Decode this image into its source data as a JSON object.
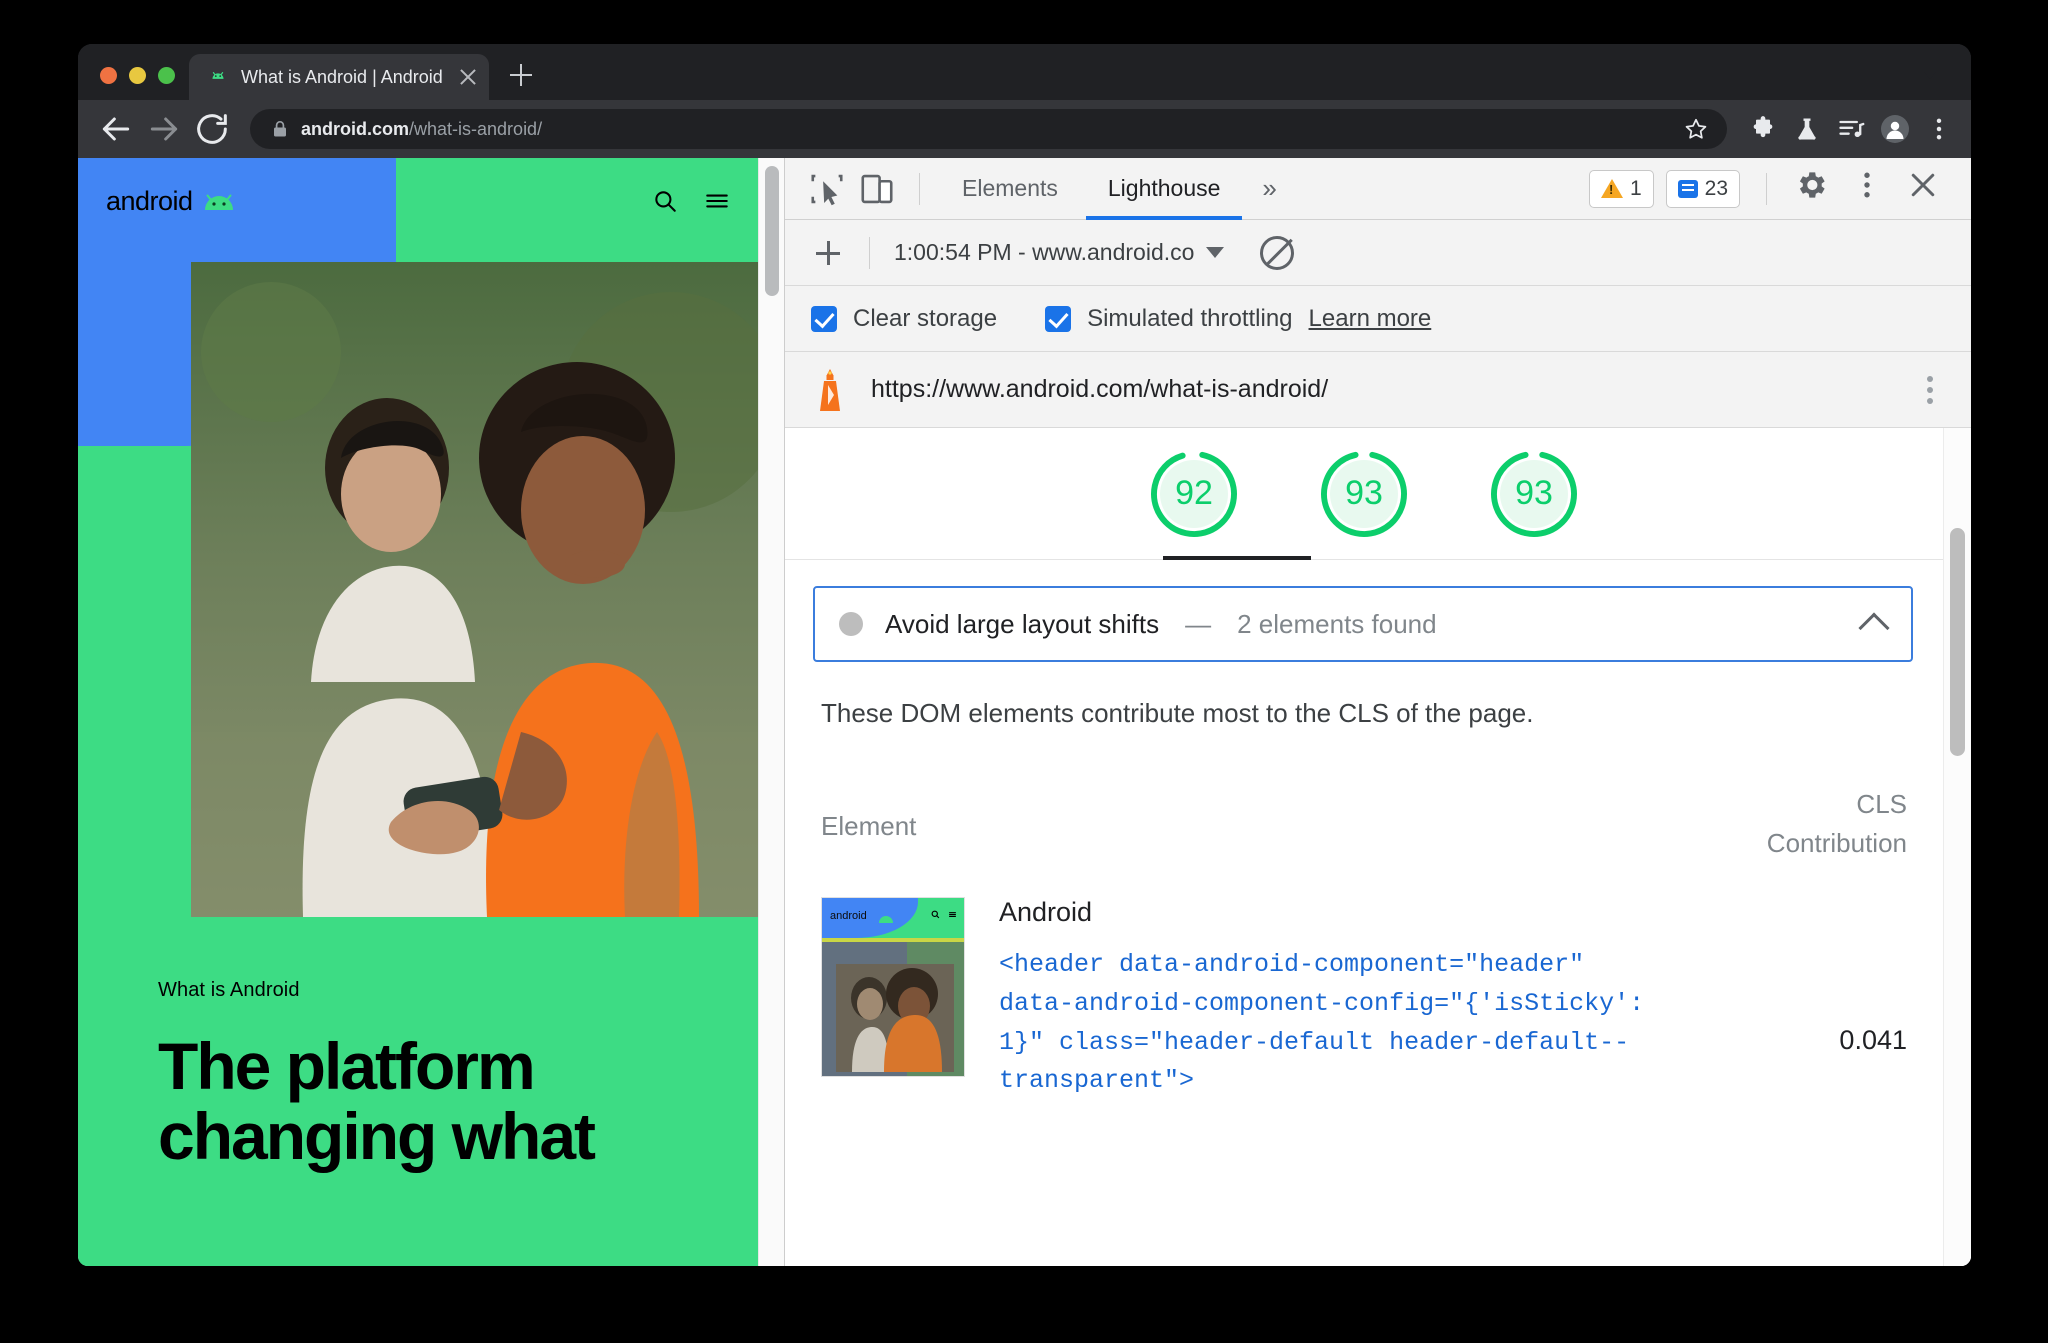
{
  "browser": {
    "traffic_lights": [
      "close",
      "minimize",
      "maximize"
    ],
    "tab": {
      "title": "What is Android | Android",
      "favicon": "android-robot-icon",
      "close": "close-icon"
    },
    "new_tab": "+",
    "tab_list_button": "caret-down-icon",
    "nav": {
      "back": "back-arrow-icon",
      "forward": "forward-arrow-icon",
      "reload": "reload-icon"
    },
    "omnibox": {
      "lock": "lock-icon",
      "url_host": "android.com",
      "url_path": "/what-is-android/",
      "bookmark": "star-icon"
    },
    "toolbar_icons": [
      "extensions-puzzle-icon",
      "flask-icon",
      "media-playlist-icon",
      "profile-avatar-icon",
      "chrome-menu-icon"
    ]
  },
  "page": {
    "logo_text": "android",
    "logo_mark": "bugdroid-icon",
    "search_icon": "search-icon",
    "menu_icon": "hamburger-menu-icon",
    "eyebrow": "What is Android",
    "headline": "The platform changing what"
  },
  "devtools": {
    "toolbar": {
      "inspect_icon": "inspect-element-icon",
      "device_icon": "device-toolbar-icon",
      "tabs": [
        {
          "label": "Elements",
          "active": false
        },
        {
          "label": "Lighthouse",
          "active": true
        }
      ],
      "more_tabs": "»",
      "warning_count": "1",
      "message_count": "23",
      "settings_icon": "gear-icon",
      "menu_icon": "kebab-menu-icon",
      "close_icon": "close-icon"
    },
    "run_row": {
      "add_icon": "plus-icon",
      "report_selector": "1:00:54 PM - www.android.co",
      "selector_caret": "caret-down-icon",
      "clear_icon": "no-entry-icon"
    },
    "options": {
      "clear_storage": {
        "label": "Clear storage",
        "checked": true
      },
      "simulated_throttling": {
        "label": "Simulated throttling",
        "checked": true
      },
      "learn_more": "Learn more"
    },
    "report_header": {
      "icon": "lighthouse-icon",
      "url": "https://www.android.com/what-is-android/",
      "menu_icon": "kebab-menu-icon"
    },
    "scores": [
      {
        "value": "92",
        "color": "#0cce6b"
      },
      {
        "value": "93",
        "color": "#0cce6b"
      },
      {
        "value": "93",
        "color": "#0cce6b"
      }
    ],
    "audit": {
      "status_icon": "neutral-circle-icon",
      "title": "Avoid large layout shifts",
      "separator": "—",
      "subtitle": "2 elements found",
      "collapse_icon": "chevron-up-icon",
      "description": "These DOM elements contribute most to the CLS of the page.",
      "table": {
        "columns": [
          "Element",
          "CLS Contribution"
        ],
        "col_cls_line1": "CLS",
        "col_cls_line2": "Contribution",
        "rows": [
          {
            "thumbnail": "page-screenshot-thumbnail",
            "element_name": "Android",
            "snippet": "<header data-android-component=\"header\" data-android-component-config=\"{'isSticky': 1}\" class=\"header-default header-default--transparent\">",
            "cls_contribution": "0.041"
          }
        ]
      }
    },
    "scrollbar": "vertical-scrollbar"
  },
  "colors": {
    "accent_blue": "#1a73e8",
    "android_green": "#3ddc84",
    "android_blue": "#4285f4",
    "score_green": "#0cce6b",
    "code_blue": "#1967d2"
  }
}
